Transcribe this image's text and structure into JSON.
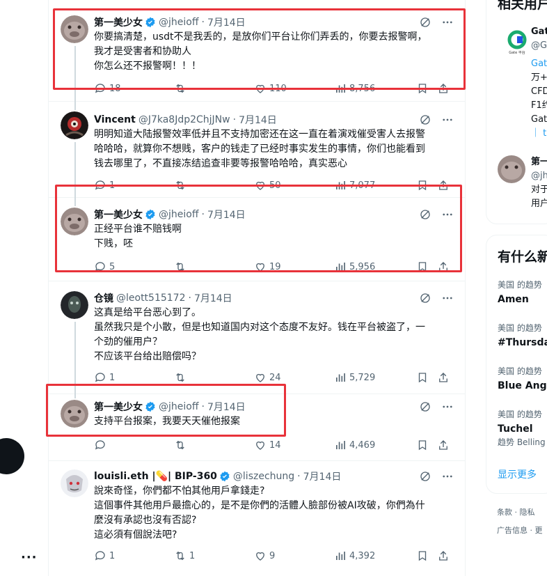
{
  "tweets": [
    {
      "name": "第一美少女",
      "verified": true,
      "handle": "@jheioff",
      "date": "7月14日",
      "lines": [
        "你要搞清楚，usdt不是我丢的，是放你们平台让你们弄丢的，你要去报警啊，",
        "我才是受害者和协助人",
        "你怎么还不报警啊！！！"
      ],
      "replies": "18",
      "retweets": "",
      "likes": "110",
      "views": "8,756"
    },
    {
      "name": "Vincent",
      "verified": false,
      "handle": "@J7ka8Jdp2ChjJNw",
      "date": "7月14日",
      "lines": [
        "明明知道大陆报警效率低并且不支持加密还在这一直在着演戏催受害人去报警",
        "哈哈哈，就算你不想贱，客户的钱走了已经时事实发生的事情，你们也能看到",
        "钱去哪里了，不直接冻结追查非要等报警哈哈哈，真实恶心"
      ],
      "replies": "1",
      "retweets": "",
      "likes": "50",
      "views": "7,077"
    },
    {
      "name": "第一美少女",
      "verified": true,
      "handle": "@jheioff",
      "date": "7月14日",
      "lines": [
        "正经平台谁不赔钱啊",
        "下贱，呸"
      ],
      "replies": "5",
      "retweets": "",
      "likes": "19",
      "views": "5,956"
    },
    {
      "name": "仓镜",
      "verified": false,
      "handle": "@leott515172",
      "date": "7月14日",
      "lines": [
        "这真是给平台恶心到了。",
        "虽然我只是个小散，但是也知道国内对这个态度不友好。钱在平台被盗了，一",
        "个劲的催用户？",
        "不应该平台给出赔偿吗？"
      ],
      "replies": "1",
      "retweets": "",
      "likes": "24",
      "views": "5,729"
    },
    {
      "name": "第一美少女",
      "verified": true,
      "handle": "@jheioff",
      "date": "7月14日",
      "lines": [
        "支持平台报案，我要天天催他报案"
      ],
      "replies": "",
      "retweets": "",
      "likes": "14",
      "views": "4,469"
    },
    {
      "name": "louisli.eth |💊| BIP-360",
      "verified": true,
      "handle": "@liszechung",
      "date": "7月14日",
      "lines": [
        "說來奇怪，你們都不怕其他用戶拿錢走?",
        "這個事件其他用戶最擔心的，是不是你們的活體人臉部份被AI攻破，你們為什",
        "麼沒有承認也沒有否認?",
        "這必須有個說法吧?"
      ],
      "replies": "1",
      "retweets": "1",
      "likes": "9",
      "views": "4,392"
    }
  ],
  "sidebar": {
    "related_title": "相关用户",
    "related": [
      {
        "name": "Gat",
        "handle": "@G",
        "bio": [
          "Gat",
          "万+",
          "CFD",
          "F1约",
          "Gat",
          "｜ t."
        ]
      },
      {
        "name": "第一",
        "handle": "@jh",
        "bio": [
          "对于",
          "用户"
        ]
      }
    ],
    "trends_title": "有什么新",
    "trends": [
      {
        "meta": "美国 的趋势",
        "name": "Amen",
        "sub": ""
      },
      {
        "meta": "美国 的趋势",
        "name": "#Thursda",
        "sub": ""
      },
      {
        "meta": "美国 的趋势",
        "name": "Blue Ange",
        "sub": ""
      },
      {
        "meta": "美国 的趋势",
        "name": "Tuchel",
        "sub": "趋势 Belling"
      }
    ],
    "show_more": "显示更多",
    "footer": [
      [
        "条款",
        "·",
        "隐私"
      ],
      [
        "广告信息",
        "·",
        "更"
      ]
    ],
    "gate_logo_text": "Gate 平台"
  },
  "colors": {
    "accent": "#1d9bf0",
    "highlight": "#e8323a",
    "muted": "#536471",
    "border": "#eff3f4"
  }
}
